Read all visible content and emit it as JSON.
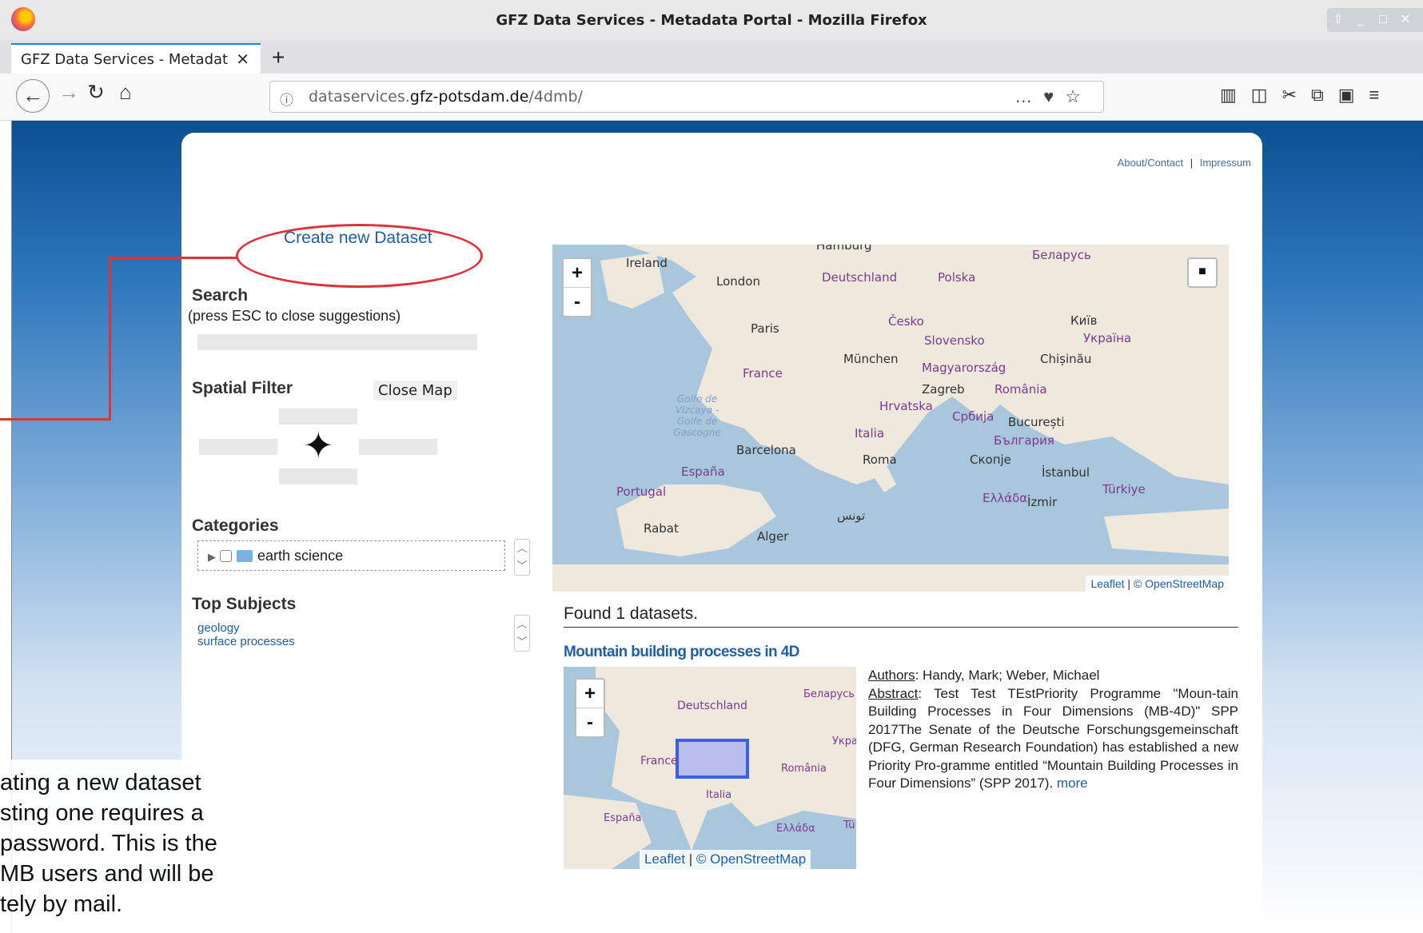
{
  "window": {
    "title": "GFZ Data Services - Metadata Portal - Mozilla Firefox"
  },
  "tab": {
    "label": "GFZ Data Services - Metadat",
    "close": "✕",
    "new": "+"
  },
  "url": {
    "prefix": "dataservices.",
    "domain": "gfz-potsdam.de",
    "path": "/4dmb/"
  },
  "links": {
    "about": "About/Contact",
    "sep": "|",
    "impressum": "Impressum"
  },
  "sidebar": {
    "create": "Create new Dataset",
    "search_title": "Search",
    "search_note": "(press ESC to close suggestions)",
    "spatial_title": "Spatial Filter",
    "close_map": "Close Map",
    "categories_title": "Categories",
    "category": "earth science",
    "top_subjects_title": "Top Subjects",
    "subjects": [
      "geology",
      "surface processes"
    ]
  },
  "map": {
    "zoom_in": "+",
    "zoom_out": "-",
    "attribution_leaflet": "Leaflet",
    "attribution_osm": "© OpenStreetMap",
    "labels": [
      "Ireland",
      "London",
      "Deutschland",
      "Polska",
      "Беларусь",
      "Paris",
      "Česko",
      "Київ",
      "Slovensko",
      "Україна",
      "France",
      "München",
      "Magyarország",
      "Chișinău",
      "Zagreb",
      "Hrvatska",
      "România",
      "Србија",
      "București",
      "Italia",
      "Barcelona",
      "Roma",
      "България",
      "Скопје",
      "España",
      "İstanbul",
      "Portugal",
      "Türkiye",
      "Ελλάδα",
      "İzmir",
      "Rabat",
      "Alger",
      "تونس",
      "Golfo de Vizcaya - Golfe de Gascogne",
      "Hamburg"
    ]
  },
  "results": {
    "found": "Found 1 datasets.",
    "dataset_title": "Mountain building processes in 4D",
    "authors_label": "Authors",
    "authors": ": Handy, Mark; Weber, Michael",
    "abstract_label": "Abstract",
    "abstract": ": Test Test TEstPriority Programme \"Moun-tain Building Processes in Four Dimensions (MB-4D)\" SPP 2017The Senate of the Deutsche Forschungsgemeinschaft (DFG, German Research Foundation) has established a new Priority Pro-gramme entitled “Mountain Building Processes in Four Dimensions” (SPP 2017).",
    "more": "more",
    "mini_labels": [
      "Deutschland",
      "Беларусь",
      "France",
      "Укра",
      "România",
      "Italia",
      "España",
      "Ελλάδα",
      "Tü"
    ]
  },
  "overlay_lines": [
    "ating a new dataset",
    "sting one requires a",
    "password. This is the",
    "MB users and will be",
    "tely by mail."
  ]
}
